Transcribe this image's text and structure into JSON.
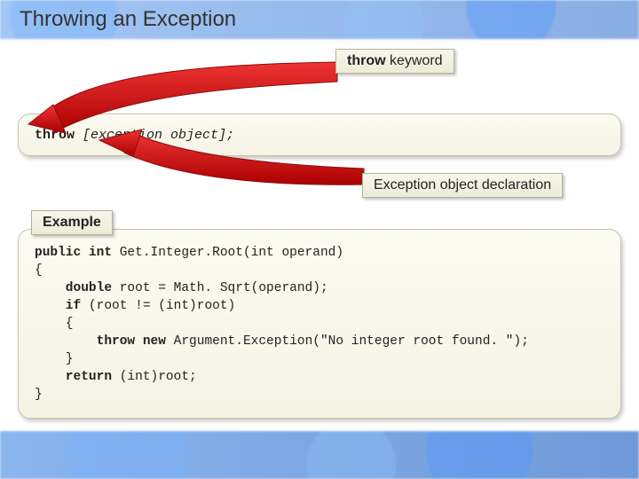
{
  "title": "Throwing an Exception",
  "labels": {
    "throw_keyword_bold": "throw",
    "throw_keyword_rest": " keyword",
    "exception_decl": "Exception object declaration",
    "example": "Example"
  },
  "syntax": {
    "kw": "throw",
    "rest": " [exception object];"
  },
  "code": {
    "l1a": "public int ",
    "l1b": "Get.Integer.Root(int operand)",
    "l2": "{",
    "l3a": "    double ",
    "l3b": "root = Math. Sqrt(operand);",
    "l4a": "    if ",
    "l4b": "(root != (int)root)",
    "l5": "    {",
    "l6a": "        throw new ",
    "l6b": "Argument.Exception(\"No integer root found. \");",
    "l7": "    }",
    "l8a": "    return ",
    "l8b": "(int)root;",
    "l9": "}"
  },
  "colors": {
    "arrow": "#c01818",
    "arrow_stroke": "#8a0d0d"
  }
}
